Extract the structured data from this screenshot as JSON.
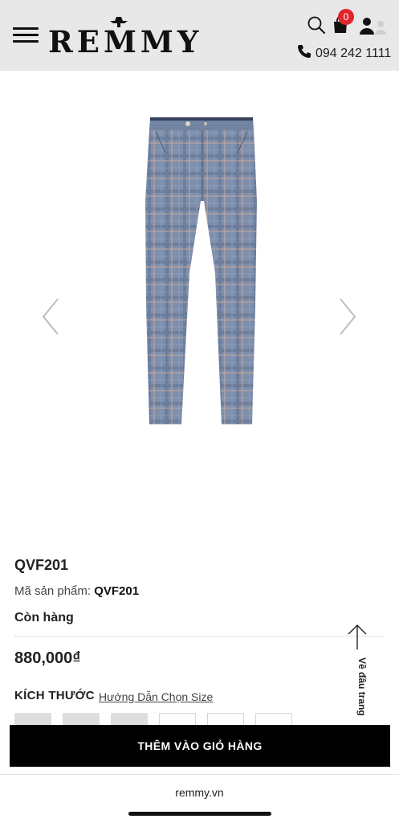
{
  "header": {
    "brand": "REMMY",
    "cart_count": "0",
    "phone": "094 242 1111"
  },
  "product": {
    "title": "QVF201",
    "sku_label": "Mã sản phẩm:",
    "sku_value": "QVF201",
    "stock_status": "Còn hàng",
    "price": "880,000₫",
    "size_label": "KÍCH THƯỚC",
    "size_guide": "Hướng Dẫn Chọn Size"
  },
  "back_to_top": "Về đầu trang",
  "cta": {
    "add_to_cart": "THÊM VÀO GIỎ HÀNG"
  },
  "footer": {
    "domain": "remmy.vn"
  },
  "icons": [
    "menu-icon",
    "search-icon",
    "shopping-bag-icon",
    "user-icon",
    "phone-icon",
    "chevron-left-icon",
    "chevron-right-icon",
    "arrow-up-icon"
  ],
  "colors": {
    "header_bg": "#e8e8e8",
    "badge": "#e0262b",
    "cta_bg": "#000000"
  }
}
